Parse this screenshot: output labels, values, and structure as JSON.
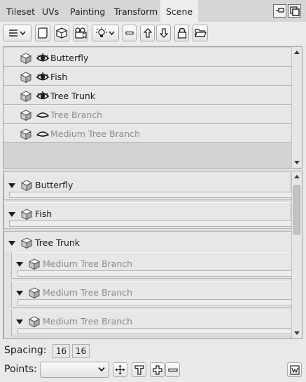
{
  "tabs": [
    {
      "label": "Tileset"
    },
    {
      "label": "UVs"
    },
    {
      "label": "Painting"
    },
    {
      "label": "Transform"
    },
    {
      "label": "Scene",
      "active": true
    }
  ],
  "toolbar_icons": [
    "menu-icon",
    "shape-icon",
    "cube-icon",
    "camera-icon",
    "lightbulb-icon",
    "minus-icon",
    "arrow-up-icon",
    "arrow-down-icon",
    "lock-icon",
    "folder-icon"
  ],
  "object_list": [
    {
      "label": "Butterfly",
      "visible": true
    },
    {
      "label": "Fish",
      "visible": true
    },
    {
      "label": "Tree Trunk",
      "visible": true
    },
    {
      "label": "Tree Branch",
      "visible": false
    },
    {
      "label": "Medium Tree Branch",
      "visible": false
    }
  ],
  "tree": [
    {
      "label": "Butterfly"
    },
    {
      "label": "Fish"
    },
    {
      "label": "Tree Trunk",
      "children": [
        {
          "label": "Medium Tree Branch"
        },
        {
          "label": "Medium Tree Branch"
        },
        {
          "label": "Medium Tree Branch"
        }
      ]
    }
  ],
  "spacing": {
    "label": "Spacing:",
    "x": "16",
    "y": "16"
  },
  "points": {
    "label": "Points:",
    "value": ""
  },
  "colors": {
    "accent": "#1f1f1f",
    "dim_text": "#8c8c8c"
  }
}
